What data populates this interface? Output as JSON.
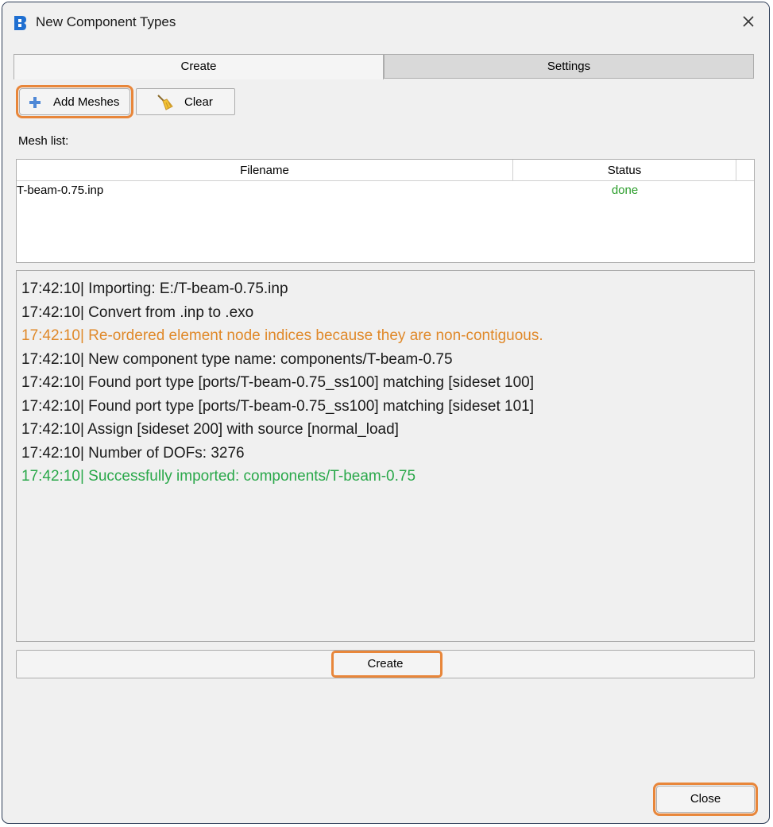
{
  "window": {
    "title": "New Component Types"
  },
  "tabs": [
    {
      "label": "Create",
      "active": true
    },
    {
      "label": "Settings",
      "active": false
    }
  ],
  "toolbar": {
    "add_meshes_label": "Add Meshes",
    "clear_label": "Clear"
  },
  "mesh_list": {
    "label": "Mesh list:",
    "columns": [
      "Filename",
      "Status"
    ],
    "rows": [
      {
        "filename": "T-beam-0.75.inp",
        "status": "done"
      }
    ]
  },
  "log": {
    "lines": [
      {
        "text": "17:42:10| Importing: E:/T-beam-0.75.inp",
        "level": "info"
      },
      {
        "text": "17:42:10| Convert from .inp to .exo",
        "level": "info"
      },
      {
        "text": "17:42:10| Re-ordered element node indices because they are non-contiguous.",
        "level": "warning"
      },
      {
        "text": "17:42:10| New component type name: components/T-beam-0.75",
        "level": "info"
      },
      {
        "text": "17:42:10| Found port type [ports/T-beam-0.75_ss100] matching [sideset 100]",
        "level": "info"
      },
      {
        "text": "17:42:10| Found port type [ports/T-beam-0.75_ss100] matching [sideset 101]",
        "level": "info"
      },
      {
        "text": "17:42:10| Assign [sideset 200] with source [normal_load]",
        "level": "info"
      },
      {
        "text": "17:42:10| Number of DOFs: 3276",
        "level": "info"
      },
      {
        "text": "17:42:10| Successfully imported: components/T-beam-0.75",
        "level": "success"
      }
    ]
  },
  "actions": {
    "create_label": "Create",
    "close_label": "Close"
  },
  "colors": {
    "warning": "#e0892a",
    "success": "#2aa84a",
    "status_done": "#2a9d2a",
    "highlight": "#e8863a",
    "icon_blue": "#1f6fd1"
  },
  "icons": [
    "app-logo-icon",
    "close-icon",
    "plus-icon",
    "broom-icon"
  ]
}
